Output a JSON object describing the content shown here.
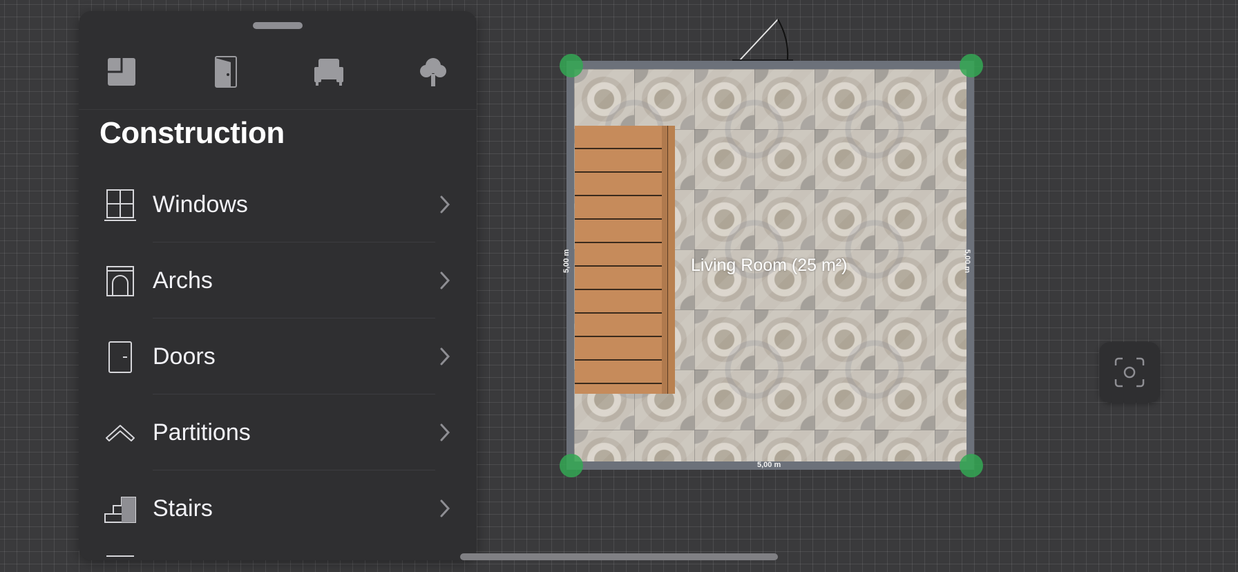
{
  "panel": {
    "categories": [
      {
        "icon": "construction-icon",
        "selected": true
      },
      {
        "icon": "door-category-icon",
        "selected": false
      },
      {
        "icon": "furniture-armchair-icon",
        "selected": false
      },
      {
        "icon": "tree-outdoor-icon",
        "selected": false
      }
    ],
    "title": "Construction",
    "items": [
      {
        "label": "Windows",
        "icon": "window-icon"
      },
      {
        "label": "Archs",
        "icon": "arch-icon"
      },
      {
        "label": "Doors",
        "icon": "door-icon"
      },
      {
        "label": "Partitions",
        "icon": "partition-icon"
      },
      {
        "label": "Stairs",
        "icon": "stairs-icon"
      }
    ]
  },
  "canvas": {
    "room_label": "Living Room (25 m²)",
    "dimensions": {
      "left": "5,00 m",
      "right": "5,00 m",
      "bottom": "5,00 m"
    }
  },
  "colors": {
    "background": "#3a3a3c",
    "panel": "#2f2f31",
    "handle": "#34a853",
    "wall": "#6c717a",
    "stairs": "#c68b5b"
  }
}
